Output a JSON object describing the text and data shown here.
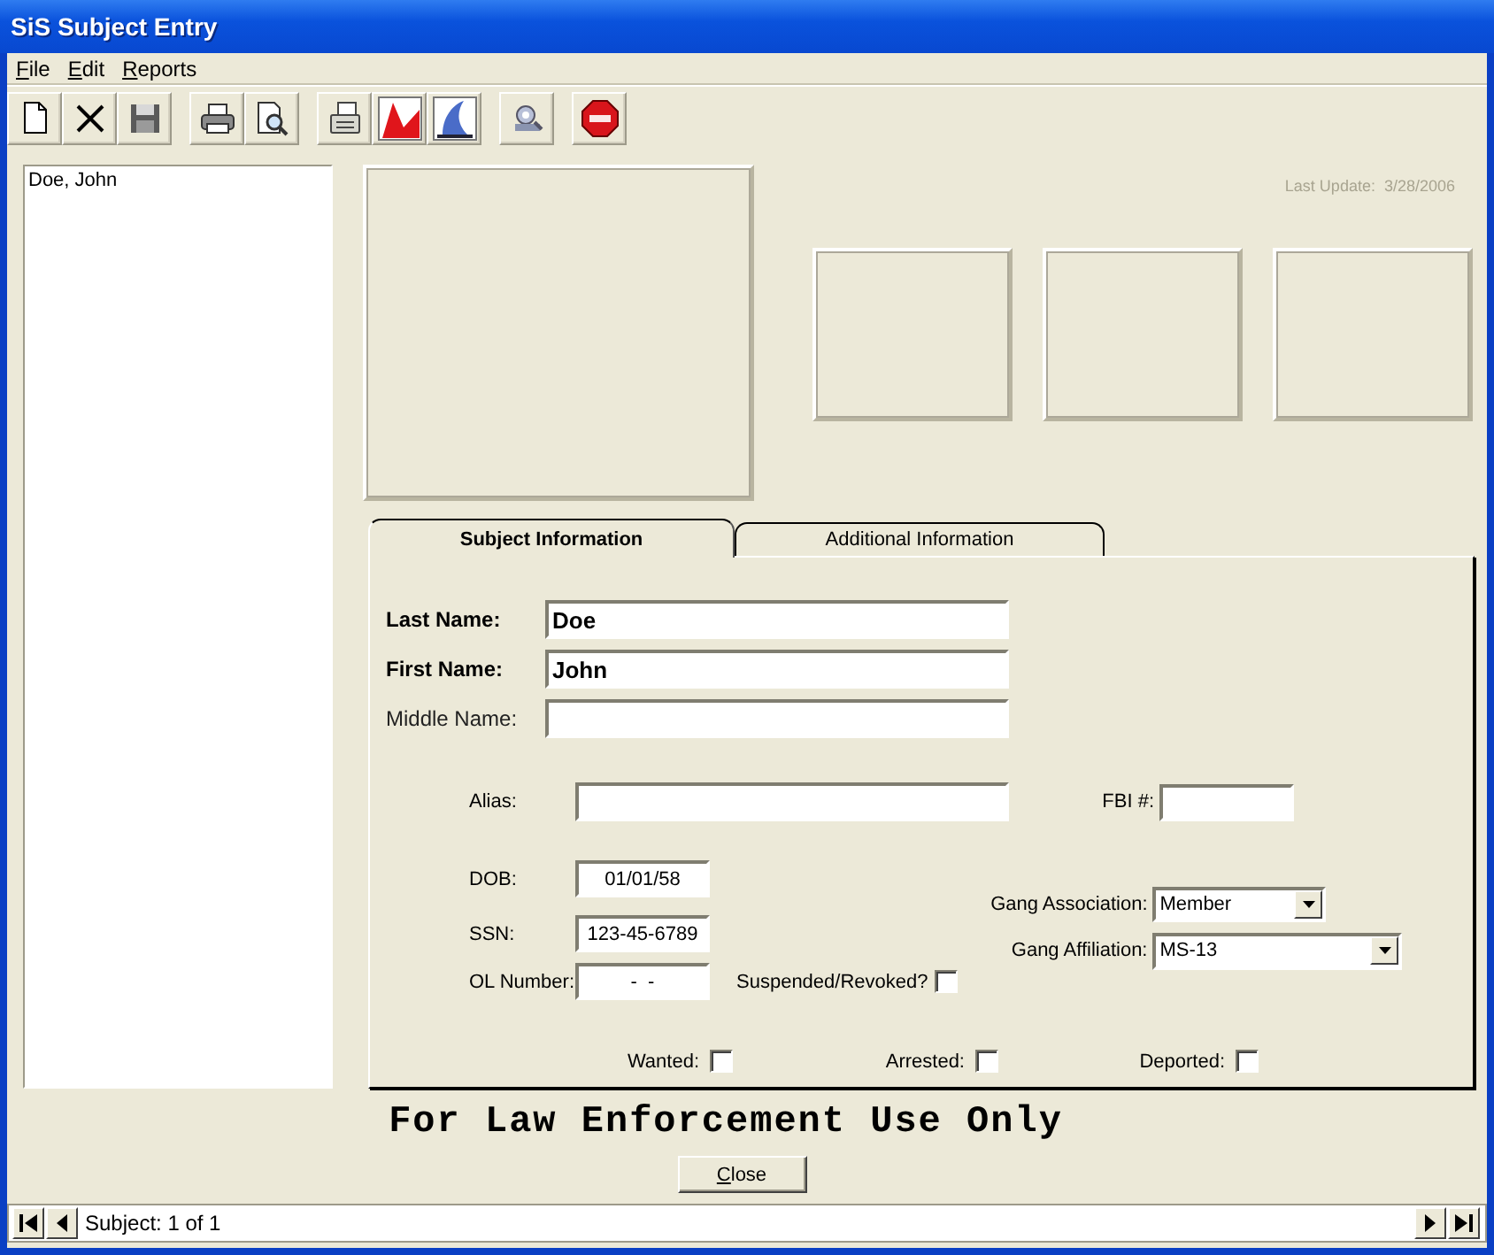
{
  "window": {
    "title": "SiS Subject Entry"
  },
  "menu": [
    {
      "label": "File"
    },
    {
      "label": "Edit"
    },
    {
      "label": "Reports"
    }
  ],
  "toolbar": [
    [
      {
        "kind": "new"
      },
      {
        "kind": "delete"
      },
      {
        "kind": "save"
      }
    ],
    [
      {
        "kind": "print"
      },
      {
        "kind": "preview"
      }
    ],
    [
      {
        "kind": "fax"
      },
      {
        "kind": "pdf"
      },
      {
        "kind": "image"
      }
    ],
    [
      {
        "kind": "tools"
      }
    ],
    [
      {
        "kind": "stop"
      }
    ]
  ],
  "subject_list": [
    {
      "label": "Doe, John"
    }
  ],
  "last_update": "Last Update:  3/28/2006",
  "tabs": [
    {
      "label": "Subject Information",
      "selected": true
    },
    {
      "label": "Additional Information",
      "selected": false
    }
  ],
  "name_fields": [
    {
      "label": "Last Name:",
      "value": "Doe",
      "bold": true
    },
    {
      "label": "First Name:",
      "value": "John",
      "bold": true
    },
    {
      "label": "Middle Name:",
      "bold": false
    }
  ],
  "alias": {
    "label": "Alias:"
  },
  "fbi": {
    "label": "FBI #:"
  },
  "id_fields": [
    {
      "label": "DOB:",
      "value": "01/01/58"
    },
    {
      "label": "SSN:",
      "value": "123-45-6789"
    },
    {
      "label": "OL Number:",
      "value": "-  -"
    }
  ],
  "suspended": {
    "label": "Suspended/Revoked?",
    "checked": false
  },
  "gang": [
    {
      "label": "Gang Association:",
      "value": "Member"
    },
    {
      "label": "Gang Affiliation:",
      "value": "MS-13"
    }
  ],
  "flags": [
    {
      "label": "Wanted:",
      "checked": false
    },
    {
      "label": "Arrested:",
      "checked": false
    },
    {
      "label": "Deported:",
      "checked": false
    }
  ],
  "banner": "For Law Enforcement Use Only",
  "close_button": "Close",
  "record_nav": {
    "text": "Subject: 1 of 1"
  }
}
